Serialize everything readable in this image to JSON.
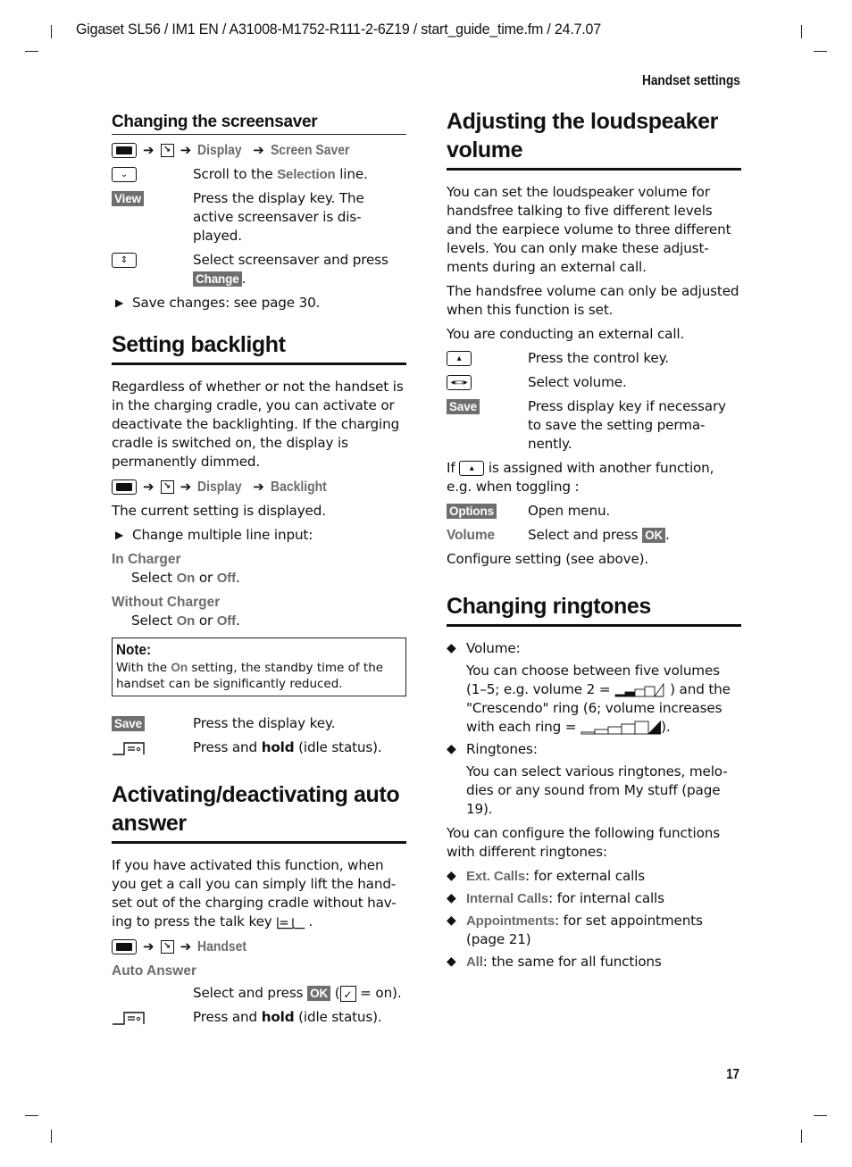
{
  "header": {
    "doc_info": "Gigaset SL56 / IM1 EN / A31008-M1752-R111-2-6Z19 / start_guide_time.fm / 24.7.07",
    "running_head": "Handset settings",
    "page_number": "17"
  },
  "screensaver": {
    "title": "Changing the screensaver",
    "path": [
      "Display",
      "Screen Saver"
    ],
    "steps": [
      {
        "icon": "control-key-down-icon",
        "pre": "Scroll to the ",
        "menu": "Selection",
        "post": " line."
      },
      {
        "softkey": "View",
        "text": "Press the display key. The active screensaver is dis-played."
      },
      {
        "icon": "control-key-updown-icon",
        "text": "Select screensaver and press ",
        "softkey_inline": "Change",
        "post": "."
      }
    ],
    "bullet": "Save changes: see page 30."
  },
  "backlight": {
    "title": "Setting backlight",
    "intro": "Regardless of whether or not the handset is in the charging cradle, you can activate or deactivate the backlighting. If the charging cradle is switched on, the display is permanently dimmed.",
    "path": [
      "Display",
      "Backlight"
    ],
    "current": "The current setting is displayed.",
    "bullet": "Change multiple line input:",
    "options": [
      {
        "label": "In Charger",
        "pre": "Select ",
        "on": "On",
        "mid": " or ",
        "off": "Off",
        "post": "."
      },
      {
        "label": "Without Charger",
        "pre": "Select ",
        "on": "On",
        "mid": " or ",
        "off": "Off",
        "post": "."
      }
    ],
    "note": {
      "title": "Note:",
      "pre": "With the ",
      "menu": "On",
      "post": " setting, the standby time of the handset can be significantly reduced."
    },
    "save_softkey": "Save",
    "save_text": "Press the display key.",
    "end_pre": "Press and ",
    "end_bold": "hold",
    "end_post": " (idle status)."
  },
  "auto_answer": {
    "title": "Activating/deactivating auto answer",
    "intro": "If you have activated this function, when you get a call you can simply lift the hand-set out of the charging cradle without hav-ing to press the talk key",
    "intro_end": ".",
    "path": [
      "Handset"
    ],
    "option_label": "Auto Answer",
    "select_pre": "Select and press ",
    "ok": "OK",
    "paren_open": " (",
    "check": "✓",
    "paren_close": " = on).",
    "end_pre": "Press and ",
    "end_bold": "hold",
    "end_post": " (idle status)."
  },
  "loudspeaker": {
    "title": "Adjusting the loudspeaker volume",
    "p1": "You can set the loudspeaker volume for handsfree talking to five different levels and the earpiece volume to three different levels. You can only make these adjust-ments during an external call.",
    "p2": "The handsfree volume can only be adjusted when this function is set.",
    "p3": "You are conducting an external call.",
    "steps": [
      {
        "icon": "control-key-up-icon",
        "text": "Press the control key."
      },
      {
        "icon": "control-key-leftright-icon",
        "text": "Select volume."
      },
      {
        "softkey": "Save",
        "text": "Press display key if necessary to save the setting perma-nently."
      }
    ],
    "if_pre": "If",
    "if_post": "is assigned with another function, e.g. when toggling :",
    "options_softkey": "Options",
    "options_text": "Open menu.",
    "volume_label": "Volume",
    "volume_pre": "Select and press ",
    "ok": "OK",
    "volume_post": ".",
    "configure": "Configure setting (see above)."
  },
  "ringtones": {
    "title": "Changing ringtones",
    "volume_head": "Volume:",
    "volume_text_1": "You can choose between five volumes (1–5; e.g. volume 2 =",
    "volume_text_2": ") and the \"Crescendo\" ring (6; volume increases with each ring =",
    "volume_text_3": ").",
    "volume_example_level": 2,
    "volume_levels": 5,
    "ringtones_head": "Ringtones:",
    "ringtones_text": "You can select various ringtones, melo-dies or any sound from My stuff (page 19).",
    "configure_intro": "You can configure the following functions with different ringtones:",
    "functions": [
      {
        "menu": "Ext. Calls",
        "text": ": for external calls"
      },
      {
        "menu": "Internal Calls",
        "text": ": for internal calls"
      },
      {
        "menu": "Appointments",
        "text": ": for set appointments (page 21)"
      },
      {
        "menu": "All",
        "text": ": the same for all functions"
      }
    ]
  },
  "colors": {
    "menu_text": "#6b6b6b",
    "softkey_bg": "#6e6e6e",
    "text": "#111111"
  }
}
